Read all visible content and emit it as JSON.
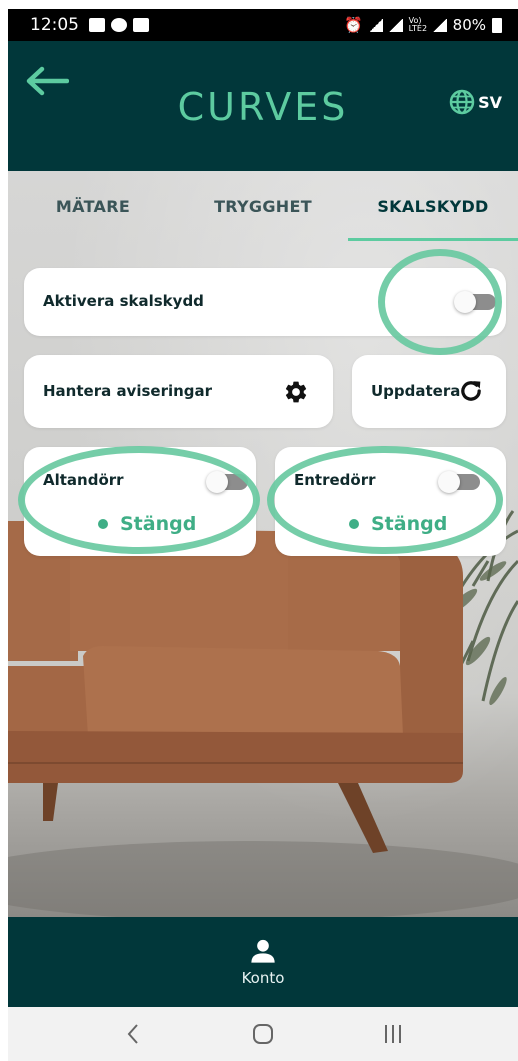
{
  "status_bar": {
    "time": "12:05",
    "battery": "80%",
    "network": "Vo) LTE2"
  },
  "header": {
    "brand": "CURVES",
    "language": "SV",
    "back_icon": "arrow-left-icon",
    "language_icon": "globe-icon"
  },
  "tabs": [
    {
      "label": "MÄTARE",
      "active": false
    },
    {
      "label": "TRYGGHET",
      "active": false
    },
    {
      "label": "SKALSKYDD",
      "active": true
    }
  ],
  "cards": {
    "activate": {
      "label": "Aktivera skalskydd",
      "enabled": false
    },
    "notifications": {
      "label": "Hantera aviseringar",
      "icon": "gear-icon"
    },
    "refresh": {
      "label": "Uppdatera",
      "icon": "refresh-icon"
    },
    "doors": [
      {
        "label": "Altandörr",
        "enabled": false,
        "status": "Stängd"
      },
      {
        "label": "Entredörr",
        "enabled": false,
        "status": "Stängd"
      }
    ]
  },
  "bottom_nav": {
    "label": "Konto",
    "icon": "person-icon"
  },
  "colors": {
    "header_bg": "#01373a",
    "accent": "#5dcba0",
    "status_green": "#3fae86"
  }
}
